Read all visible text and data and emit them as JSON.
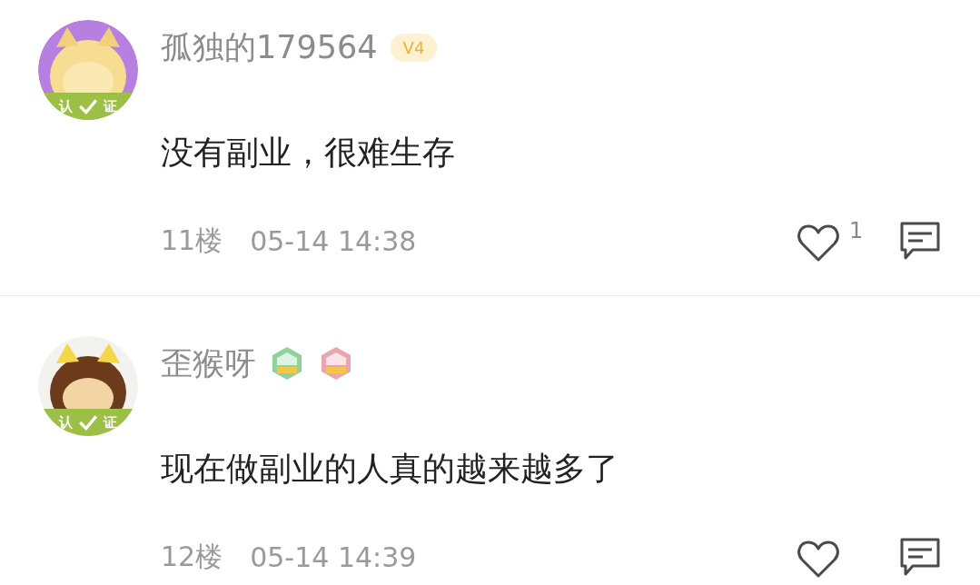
{
  "comments": [
    {
      "user": {
        "name": "孤独的179564",
        "verified": true,
        "verify_left": "认",
        "verify_right": "证",
        "badges": [
          {
            "kind": "level",
            "text": "V4"
          }
        ]
      },
      "text": "没有副业，很难生存",
      "floor": "11楼",
      "time": "05-14 14:38",
      "likes": "1"
    },
    {
      "user": {
        "name": "歪猴呀",
        "verified": true,
        "verify_left": "认",
        "verify_right": "证",
        "badges": [
          {
            "kind": "medal",
            "color": "#8fd39a"
          },
          {
            "kind": "medal",
            "color": "#eaa6ae"
          }
        ]
      },
      "text": "现在做副业的人真的越来越多了",
      "floor": "12楼",
      "time": "05-14 14:39"
    }
  ]
}
